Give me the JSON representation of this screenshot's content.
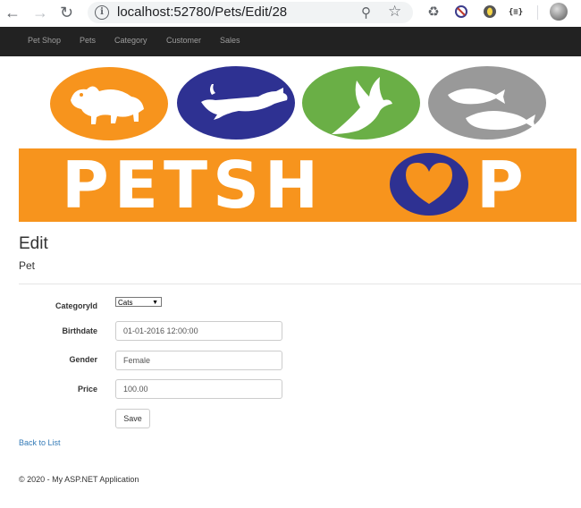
{
  "browser": {
    "url": "localhost:52780/Pets/Edit/28"
  },
  "navbar": {
    "items": [
      "Pet Shop",
      "Pets",
      "Category",
      "Customer",
      "Sales"
    ]
  },
  "banner": {
    "logo_text": "PETSHOP",
    "animals": [
      "dog-and-cat",
      "cat",
      "bird",
      "fish"
    ],
    "colors": {
      "orange": "#f7941d",
      "blue": "#2e3192",
      "green": "#6aaf46",
      "gray": "#999999"
    }
  },
  "page": {
    "title": "Edit",
    "subtitle": "Pet"
  },
  "form": {
    "category_label": "CategoryId",
    "category_value": "Cats",
    "birthdate_label": "Birthdate",
    "birthdate_value": "01-01-2016 12:00:00",
    "gender_label": "Gender",
    "gender_value": "Female",
    "price_label": "Price",
    "price_value": "100.00",
    "save_label": "Save"
  },
  "back_link": "Back to List",
  "footer": "© 2020 - My ASP.NET Application"
}
